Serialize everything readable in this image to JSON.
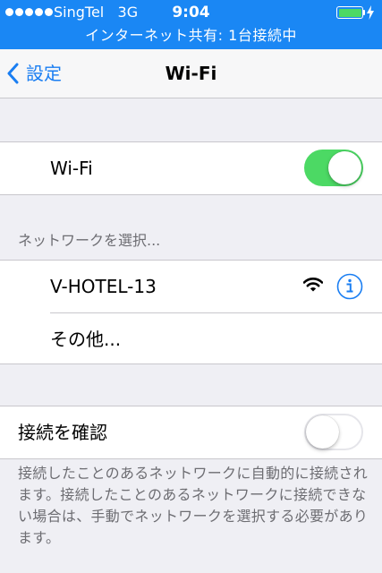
{
  "status_bar": {
    "carrier": "SingTel",
    "network": "3G",
    "time": "9:04",
    "banner": "インターネット共有: 1台接続中",
    "battery_level": 1.0,
    "colors": {
      "background": "#1a87f4",
      "battery": "#4cd964"
    }
  },
  "nav": {
    "back_label": "設定",
    "title": "Wi-Fi"
  },
  "wifi_toggle": {
    "label": "Wi-Fi",
    "state": "on"
  },
  "networks": {
    "header": "ネットワークを選択...",
    "items": [
      {
        "name": "V-HOTEL-13",
        "icon": "wifi-signal-icon",
        "accessory": "info-icon"
      },
      {
        "name": "その他..."
      }
    ]
  },
  "ask_to_join": {
    "label": "接続を確認",
    "state": "off",
    "footer": "接続したことのあるネットワークに自動的に接続されます。接続したことのあるネットワークに接続できない場合は、手動でネットワークを選択する必要があります。"
  },
  "colors": {
    "accent": "#1a7ef2",
    "switch_on": "#4cd964",
    "grouped_background": "#efeff4"
  }
}
